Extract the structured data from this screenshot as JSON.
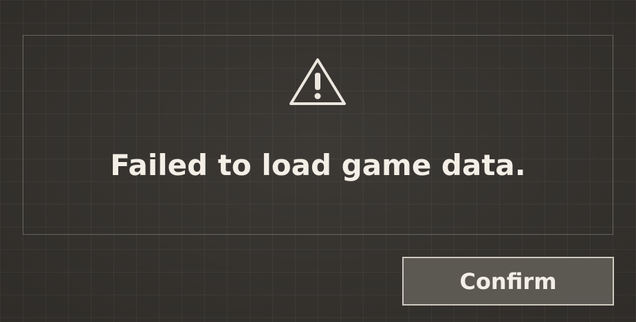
{
  "dialog": {
    "icon": "warning-triangle-icon",
    "message": "Failed to load game data.",
    "confirm_label": "Confirm"
  },
  "colors": {
    "background": "#35322e",
    "text": "#f4efe6",
    "button_fill": "#5c5953",
    "button_border": "#cfcac0"
  }
}
